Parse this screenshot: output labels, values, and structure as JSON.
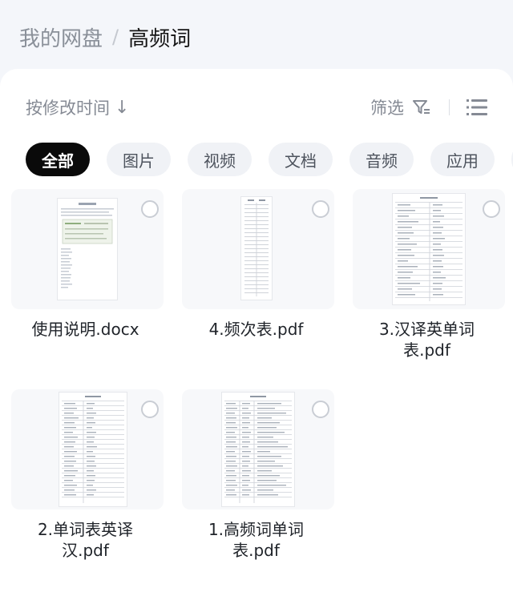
{
  "breadcrumb": {
    "root": "我的网盘",
    "separator": "/",
    "current": "高频词"
  },
  "toolbar": {
    "sort_label": "按修改时间",
    "sort_arrow": "↓",
    "filter_label": "筛选"
  },
  "chips": [
    "全部",
    "图片",
    "视频",
    "文档",
    "音频",
    "应用"
  ],
  "files": [
    {
      "name": "使用说明.docx",
      "kind": "docx"
    },
    {
      "name": "4.频次表.pdf",
      "kind": "pdf-narrow"
    },
    {
      "name": "3.汉译英单词表.pdf",
      "kind": "pdf-wide"
    },
    {
      "name": "2.单词表英译汉.pdf",
      "kind": "pdf-table"
    },
    {
      "name": "1.高频词单词表.pdf",
      "kind": "pdf-list"
    }
  ]
}
